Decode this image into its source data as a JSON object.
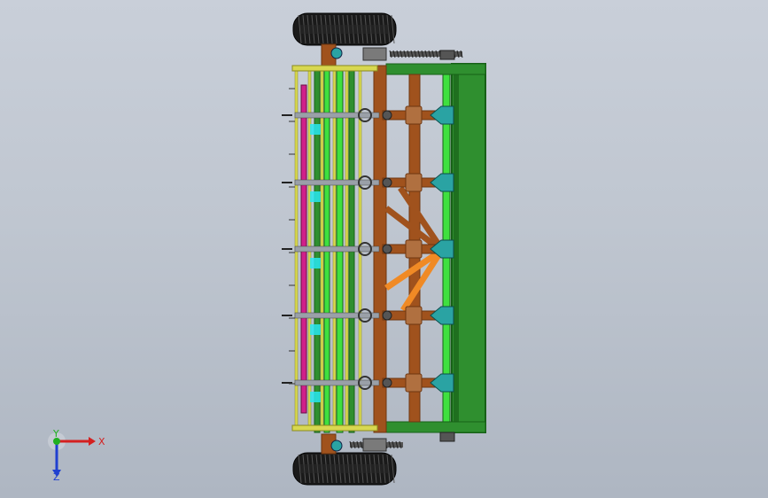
{
  "view": {
    "background": "#c4cad4",
    "colors": {
      "frame_green": "#2f8f2f",
      "frame_green_dark": "#176017",
      "bright_green": "#3fe03f",
      "brown": "#a0521d",
      "brown_dark": "#6e3610",
      "yellow_tine": "#d8d850",
      "magenta": "#d0208a",
      "teal": "#2aa3a3",
      "cyan": "#28e8f0",
      "orange": "#f08a25",
      "tire": "#1a1a1a",
      "steel": "#9aa0a8"
    }
  },
  "triad": {
    "x_label": "X",
    "z_label": "Z",
    "y_label": "Y",
    "x_color": "#d42020",
    "y_color": "#20b020",
    "z_color": "#2040d0"
  }
}
